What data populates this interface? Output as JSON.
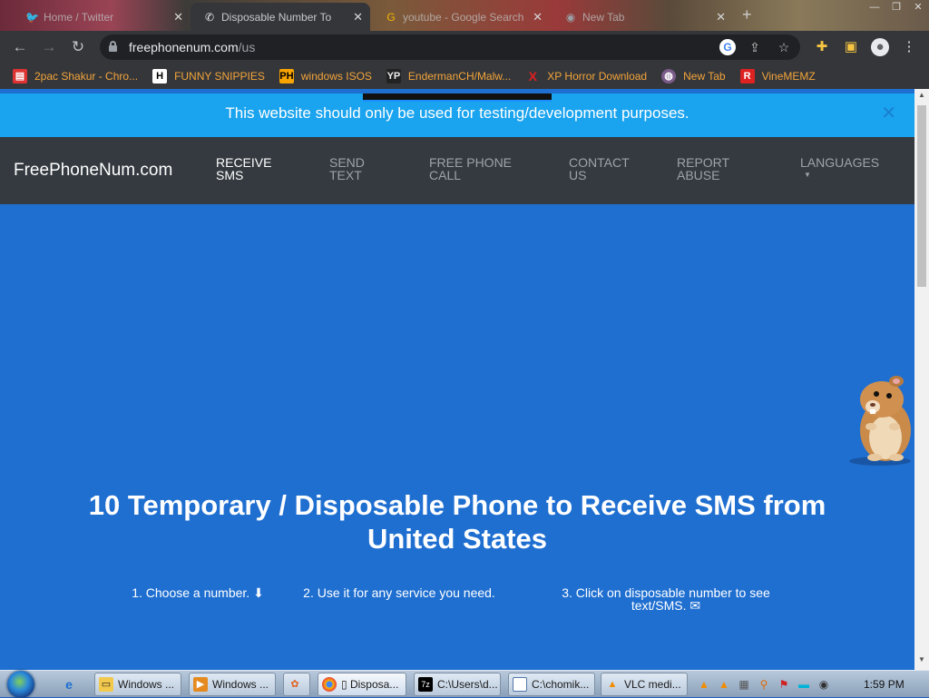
{
  "browser": {
    "tabs": [
      {
        "title": "Home / Twitter",
        "active": false
      },
      {
        "title": "Disposable Number To",
        "active": true
      },
      {
        "title": "youtube - Google Search",
        "active": false
      },
      {
        "title": "New Tab",
        "active": false
      }
    ],
    "omnibox": {
      "domain": "freephonenum.com",
      "path": "/us"
    },
    "bookmarks": [
      {
        "label": "2pac Shakur - Chro...",
        "icon": "bag-icon"
      },
      {
        "label": "FUNNY SNIPPIES",
        "icon": "H"
      },
      {
        "label": "windows ISOS",
        "icon": "PH"
      },
      {
        "label": "EndermanCH/Malw...",
        "icon": "YP"
      },
      {
        "label": "XP Horror Download",
        "icon": "X"
      },
      {
        "label": "New Tab",
        "icon": "globe-icon"
      },
      {
        "label": "VineMEMZ",
        "icon": "R"
      }
    ]
  },
  "site": {
    "notice": "This website should only be used for testing/development purposes.",
    "brand": "FreePhoneNum.com",
    "nav": [
      {
        "line1": "RECEIVE",
        "line2": "SMS",
        "active": true
      },
      {
        "line1": "SEND",
        "line2": "TEXT",
        "active": false
      },
      {
        "line1": "FREE PHONE",
        "line2": "CALL",
        "active": false
      },
      {
        "line1": "CONTACT",
        "line2": "US",
        "active": false
      },
      {
        "line1": "REPORT",
        "line2": "ABUSE",
        "active": false
      },
      {
        "line1": "LANGUAGES",
        "line2": "",
        "active": false
      }
    ],
    "hero": {
      "title_line1": "10 Temporary / Disposable Phone to Receive SMS from",
      "title_line2": "United States",
      "steps": [
        {
          "line1": "1. Choose a number. ⬇",
          "line2": ""
        },
        {
          "line1": "2. Use it for any service you need.",
          "line2": ""
        },
        {
          "line1": "3. Click on disposable number to see",
          "line2": "text/SMS. ✉"
        }
      ]
    }
  },
  "taskbar": {
    "items": [
      {
        "label": "Windows ...",
        "icon": "folder-icon"
      },
      {
        "label": "Windows ...",
        "icon": "media-player-icon"
      },
      {
        "label": "",
        "icon": "app-icon"
      },
      {
        "label": "▯ Disposa...",
        "icon": "chrome-icon"
      },
      {
        "label": "C:\\Users\\d...",
        "icon": "7zip-icon"
      },
      {
        "label": "C:\\chomik...",
        "icon": "window-icon"
      },
      {
        "label": "VLC medi...",
        "icon": "vlc-icon"
      }
    ],
    "clock": "1:59 PM"
  },
  "colors": {
    "page_background": "#1f6fd1",
    "notice_background": "#1aa3ee",
    "navbar_background": "#343a40",
    "bookmark_text": "#f3a53a"
  }
}
